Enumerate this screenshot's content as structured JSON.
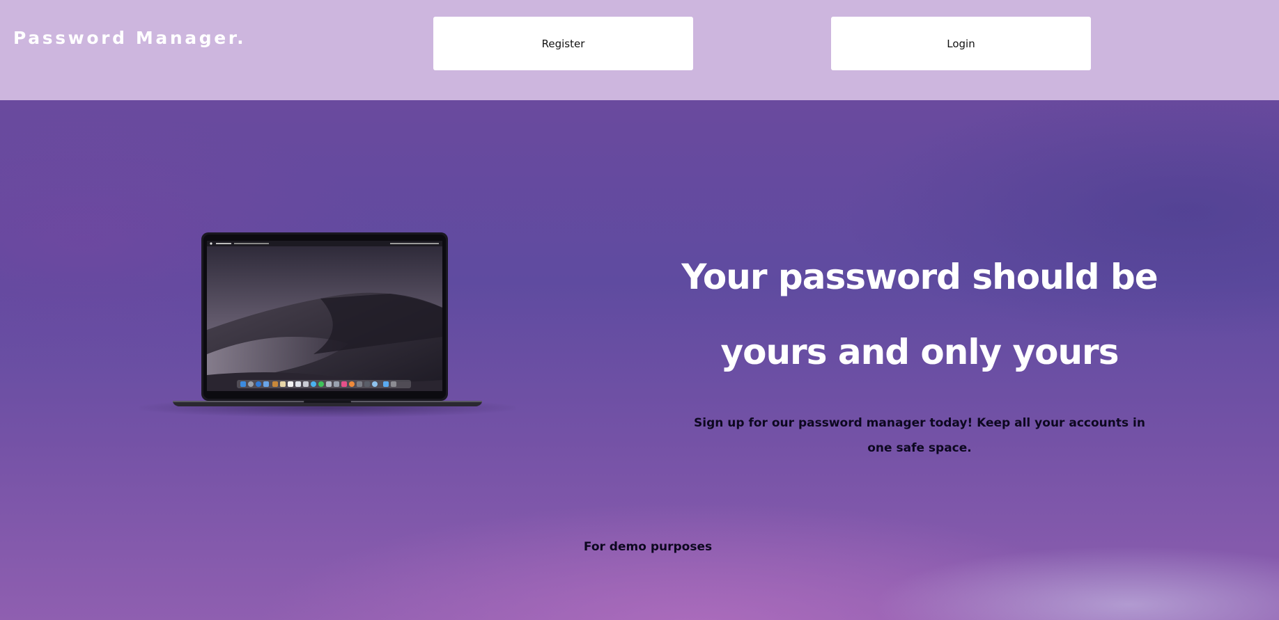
{
  "header": {
    "brand": "Password Manager.",
    "register_label": "Register",
    "login_label": "Login"
  },
  "hero": {
    "headline": "Your password should be yours and only yours",
    "subtitle": "Sign up for our password manager today! Keep all your accounts in one safe space.",
    "footer_note": "For demo purposes",
    "image": "laptop-illustration"
  },
  "colors": {
    "header_bg": "#cdb6de",
    "hero_top": "#6a4a9e",
    "hero_bottom": "#8f5fb0",
    "headline_text": "#ffffff",
    "body_text": "#0d0820",
    "button_bg": "#ffffff"
  }
}
